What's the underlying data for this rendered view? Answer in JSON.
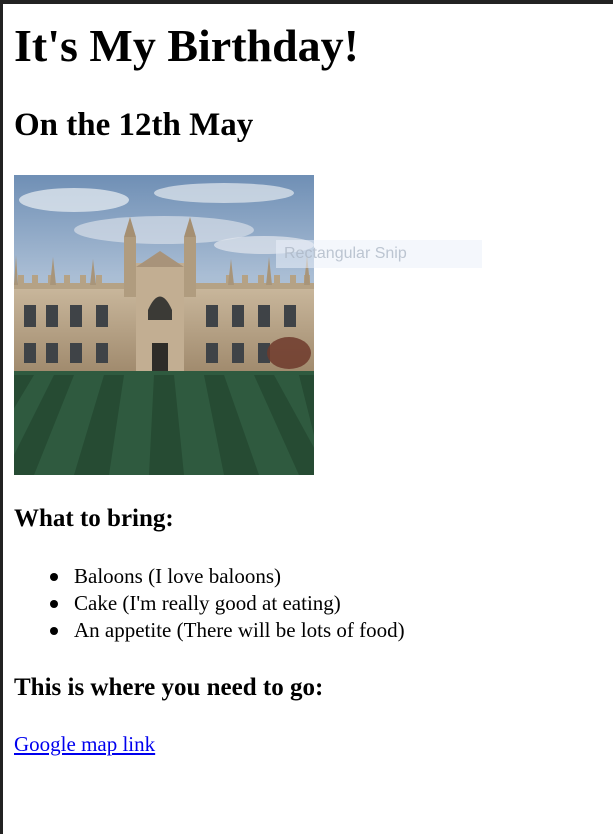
{
  "page": {
    "title": "It's My Birthday!",
    "subtitle": "On the 12th May"
  },
  "image": {
    "description_icon": "college-building-photo"
  },
  "overlay": {
    "snip_text": "Rectangular Snip"
  },
  "bring_section": {
    "heading": "What to bring:",
    "items": [
      {
        "label": "Baloons (I love baloons)"
      },
      {
        "label": "Cake (I'm really good at eating)"
      },
      {
        "label": "An appetite (There will be lots of food)"
      }
    ]
  },
  "location_section": {
    "heading": "This is where you need to go:",
    "link_text": "Google map link"
  },
  "colors": {
    "link": "#0000ee",
    "frame": "#222222",
    "text": "#000000"
  }
}
